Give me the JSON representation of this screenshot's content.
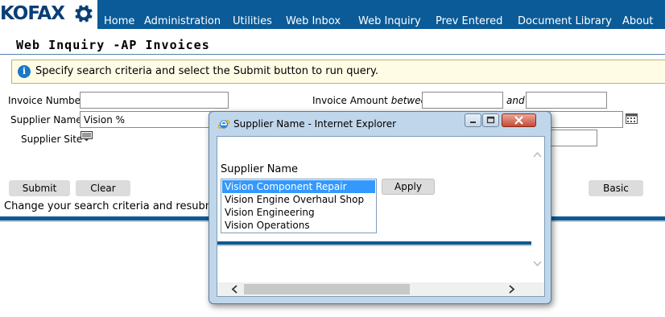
{
  "header": {
    "logo_text": "KOFAX",
    "nav": [
      "Home",
      "Administration",
      "Utilities",
      "Web Inbox",
      "Web Inquiry",
      "Prev Entered",
      "Document Library",
      "About"
    ]
  },
  "page": {
    "title": "Web Inquiry -AP Invoices",
    "info_message": "Specify search criteria and select the Submit button to run query.",
    "result_message": "Change your search criteria and resubmi"
  },
  "form": {
    "invoice_number_label": "Invoice Number",
    "invoice_number_value": "",
    "supplier_name_label": "Supplier Name",
    "supplier_name_value": "Vision %",
    "supplier_site_label": "Supplier Site",
    "invoice_amount_label": "Invoice Amount",
    "between_label": "between",
    "and_label": "and",
    "amount_from_value": "",
    "amount_to_value": "",
    "submit_label": "Submit",
    "clear_label": "Clear",
    "basic_label": "Basic"
  },
  "popup": {
    "window_title": "Supplier Name - Internet Explorer",
    "field_label": "Supplier Name",
    "options": [
      "Vision Component Repair",
      "Vision Engine Overhaul Shop",
      "Vision Engineering",
      "Vision Operations"
    ],
    "selected_option": "Vision Component Repair",
    "apply_label": "Apply"
  },
  "colors": {
    "header_bg": "#0a5b98",
    "selection": "#3399ff",
    "info_bg": "#fffce6"
  }
}
